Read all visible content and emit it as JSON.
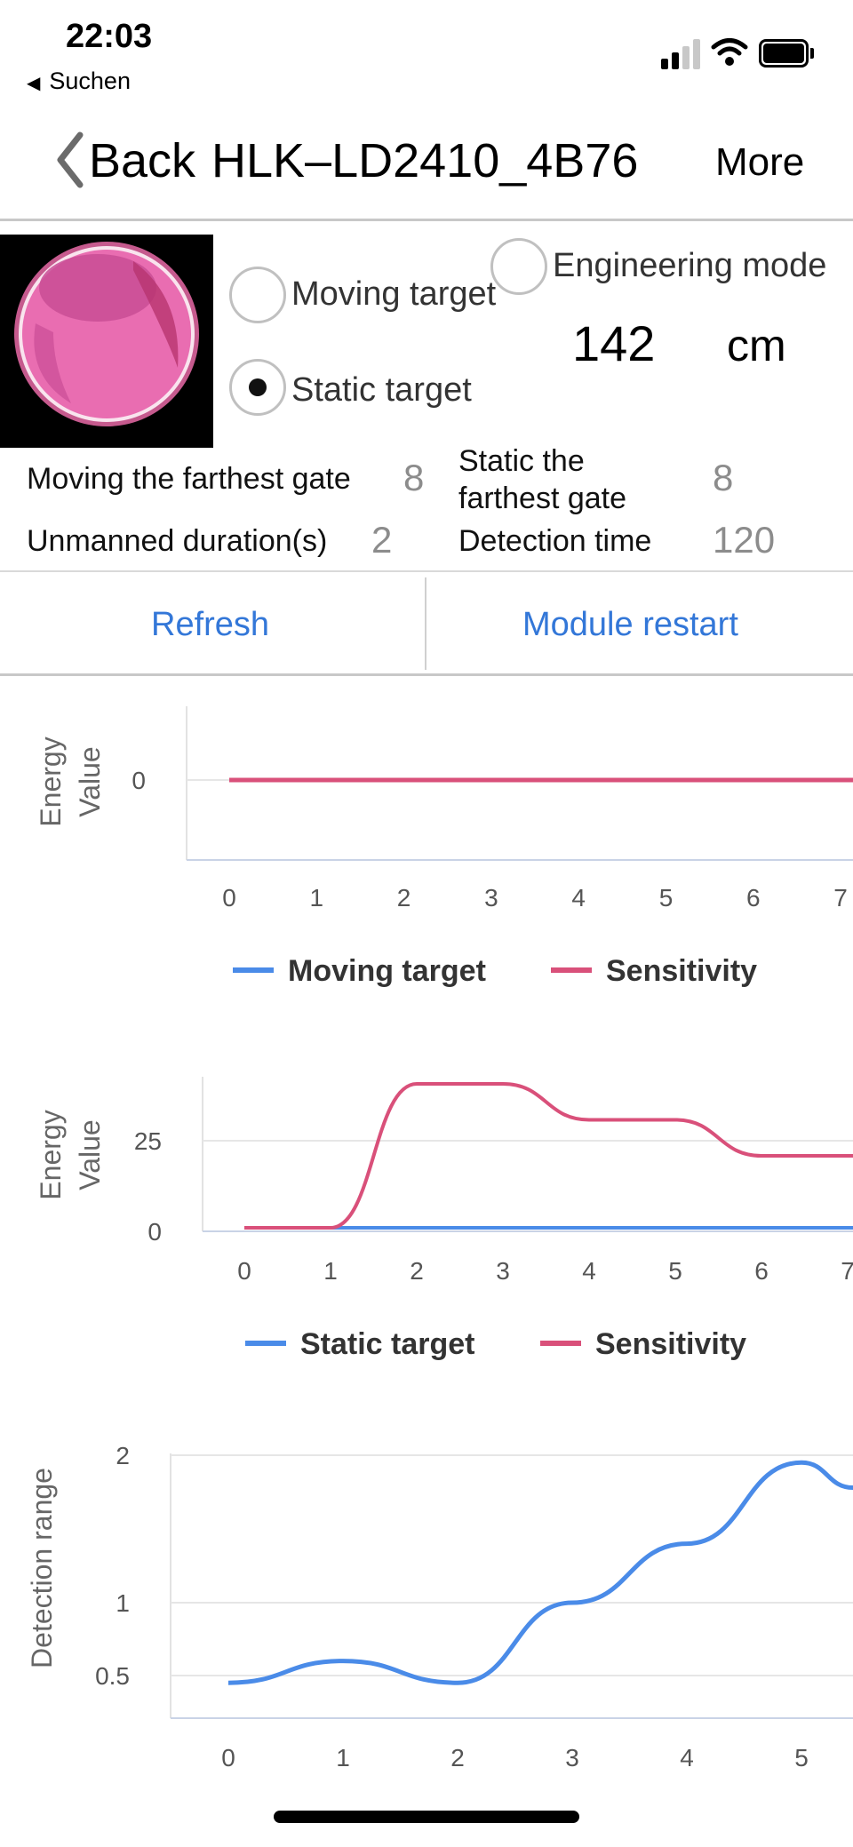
{
  "status_bar": {
    "time": "22:03",
    "back_app": "Suchen"
  },
  "nav": {
    "back_label": "Back",
    "title": "HLK–LD2410_4B76",
    "more_label": "More"
  },
  "modes": {
    "engineering_mode": "Engineering mode",
    "moving_target": "Moving target",
    "static_target": "Static target",
    "selected": "Static target"
  },
  "distance": {
    "value": "142",
    "unit": "cm"
  },
  "params": {
    "moving_gate_label": "Moving the farthest gate",
    "moving_gate_value": "8",
    "static_gate_label_line1": "Static the",
    "static_gate_label_line2": "farthest gate",
    "static_gate_value": "8",
    "unmanned_label": "Unmanned duration(s)",
    "unmanned_value": "2",
    "detection_time_label": "Detection time",
    "detection_time_value": "120"
  },
  "actions": {
    "refresh": "Refresh",
    "module_restart": "Module restart"
  },
  "colors": {
    "accent": "#3377d8",
    "moving_line": "#4a8be8",
    "sensitivity_line": "#d9507a"
  },
  "chart_data": [
    {
      "type": "line",
      "ylabel_line1": "Energy",
      "ylabel_line2": "Value",
      "x": [
        0,
        1,
        2,
        3,
        4,
        5,
        6,
        7
      ],
      "y_ticks": [
        "0"
      ],
      "x_ticks": [
        "0",
        "1",
        "2",
        "3",
        "4",
        "5",
        "6",
        "7"
      ],
      "series": [
        {
          "name": "Moving target",
          "values": [
            0,
            0,
            0,
            0,
            0,
            0,
            0,
            0
          ]
        },
        {
          "name": "Sensitivity",
          "values": [
            0,
            0,
            0,
            0,
            0,
            0,
            0,
            0
          ]
        }
      ]
    },
    {
      "type": "line",
      "ylabel_line1": "Energy",
      "ylabel_line2": "Value",
      "x": [
        0,
        1,
        2,
        3,
        4,
        5,
        6,
        7
      ],
      "y_ticks": [
        "0",
        "25"
      ],
      "x_ticks": [
        "0",
        "1",
        "2",
        "3",
        "4",
        "5",
        "6",
        "7"
      ],
      "ylim": [
        0,
        40
      ],
      "series": [
        {
          "name": "Static target",
          "values": [
            0,
            0,
            0,
            0,
            0,
            0,
            0,
            0
          ]
        },
        {
          "name": "Sensitivity",
          "values": [
            0,
            0,
            40,
            40,
            30,
            30,
            20,
            20
          ]
        }
      ]
    },
    {
      "type": "line",
      "ylabel": "Detection range",
      "x": [
        0,
        1,
        2,
        3,
        4,
        5
      ],
      "y_ticks": [
        "0.5",
        "1",
        "2"
      ],
      "x_ticks": [
        "0",
        "1",
        "2",
        "3",
        "4",
        "5"
      ],
      "ylim": [
        0.35,
        2
      ],
      "series": [
        {
          "name": "Detection range",
          "values": [
            0.45,
            0.6,
            0.45,
            1.0,
            1.4,
            1.95
          ]
        }
      ]
    }
  ]
}
